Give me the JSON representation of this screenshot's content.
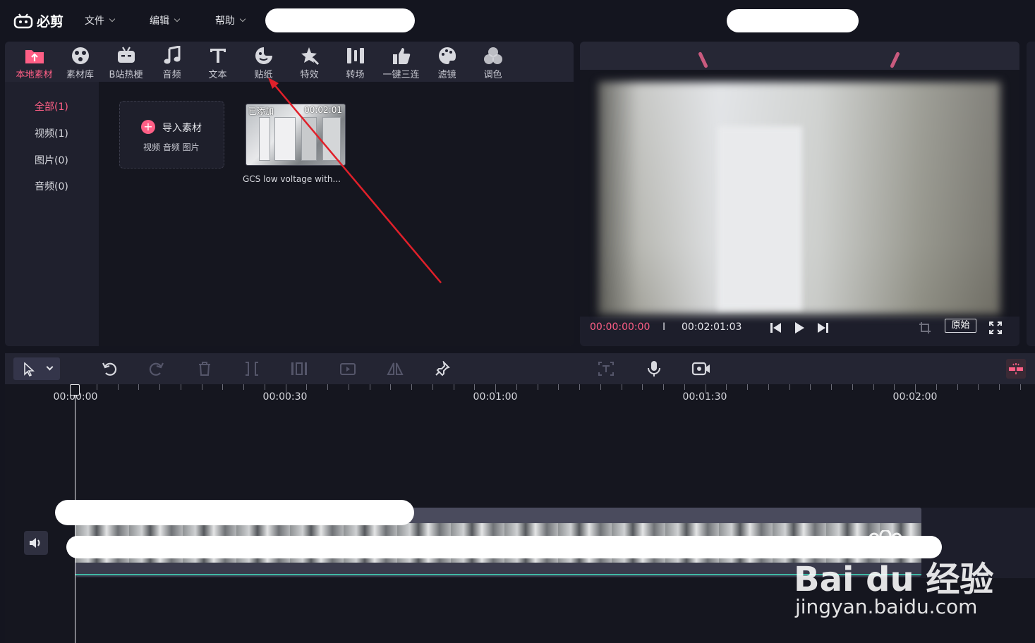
{
  "app": {
    "logo_text": "必剪"
  },
  "menu": [
    {
      "label": "文件"
    },
    {
      "label": "编辑"
    },
    {
      "label": "帮助"
    }
  ],
  "media_tabs": [
    {
      "label": "本地素材",
      "icon": "upload-folder-icon",
      "active": true
    },
    {
      "label": "素材库",
      "icon": "library-icon"
    },
    {
      "label": "B站热梗",
      "icon": "bilibili-tv-icon"
    },
    {
      "label": "音频",
      "icon": "music-note-icon"
    },
    {
      "label": "文本",
      "icon": "text-t-icon"
    },
    {
      "label": "贴纸",
      "icon": "sticker-icon"
    },
    {
      "label": "特效",
      "icon": "effect-star-icon"
    },
    {
      "label": "转场",
      "icon": "transition-icon"
    },
    {
      "label": "一键三连",
      "icon": "thumbs-up-icon"
    },
    {
      "label": "滤镜",
      "icon": "palette-icon"
    },
    {
      "label": "调色",
      "icon": "color-circles-icon"
    }
  ],
  "categories": [
    {
      "label": "全部(1)",
      "active": true
    },
    {
      "label": "视频(1)"
    },
    {
      "label": "图片(0)"
    },
    {
      "label": "音频(0)"
    }
  ],
  "import_card": {
    "title": "导入素材",
    "subtitle": "视频 音频 图片"
  },
  "media_item": {
    "badge": "已添加",
    "duration": "00:02:01",
    "name": "GCS low voltage with..."
  },
  "preview": {
    "current_time": "00:00:00:00",
    "separator": "I",
    "total_time": "00:02:01:03",
    "original_label": "原始"
  },
  "timeline": {
    "ruler_labels": [
      "00:00:00",
      "00:00:30",
      "00:01:00",
      "00:01:30",
      "00:02:00"
    ]
  },
  "watermark": {
    "brand": "Bai du 经验",
    "url": "jingyan.baidu.com"
  },
  "colors": {
    "accent": "#ff5f86",
    "panel": "#1d1e2b",
    "background": "#14151f",
    "track_line": "#3fb8a5",
    "annotation_arrow": "#e0202a"
  }
}
